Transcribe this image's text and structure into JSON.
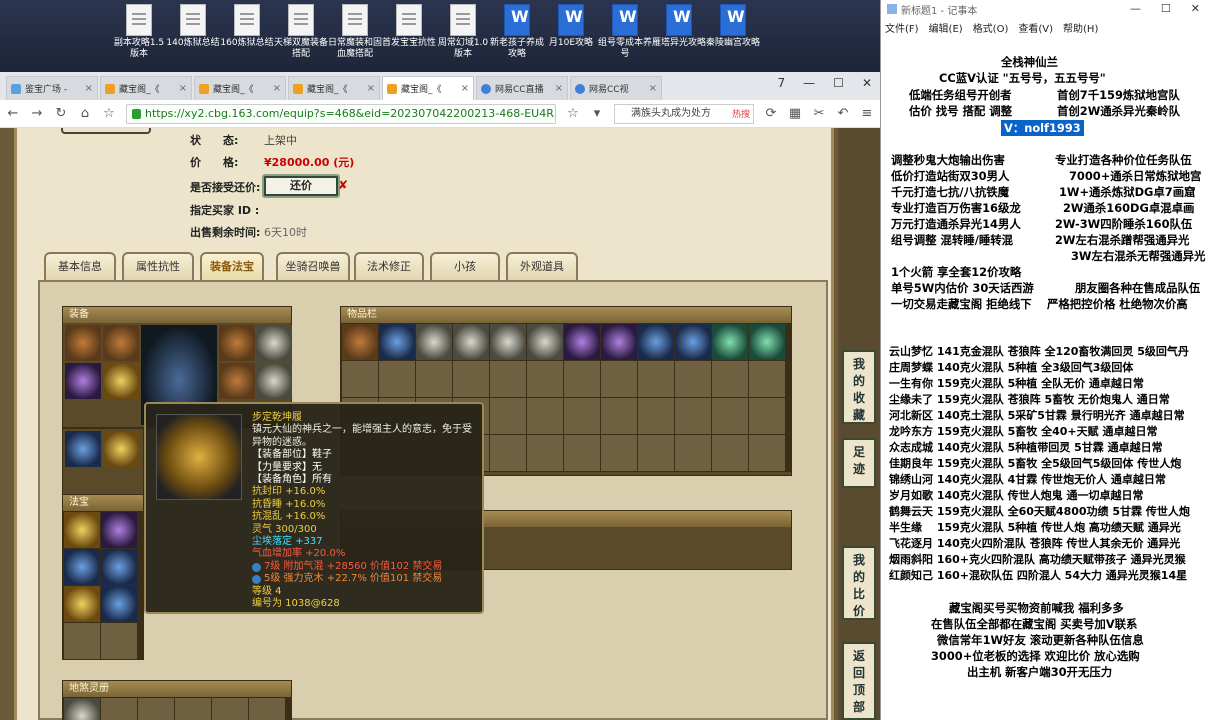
{
  "desktop": {
    "icons": [
      {
        "label": "副本攻略1.5版本",
        "type": "doc"
      },
      {
        "label": "140炼狱总结",
        "type": "doc"
      },
      {
        "label": "160炼狱总结",
        "type": "doc"
      },
      {
        "label": "天梯双魔装备搭配",
        "type": "doc"
      },
      {
        "label": "日常魔装和固血魔搭配",
        "type": "doc"
      },
      {
        "label": "首发宝宝抗性",
        "type": "doc"
      },
      {
        "label": "周常幻域1.0版本",
        "type": "doc"
      },
      {
        "label": "新老孩子养成攻略",
        "type": "word"
      },
      {
        "label": "月10E攻略",
        "type": "word"
      },
      {
        "label": "组号零成本养号",
        "type": "word"
      },
      {
        "label": "雁塔异光攻略",
        "type": "word"
      },
      {
        "label": "秦陵幽宫攻略",
        "type": "word"
      }
    ]
  },
  "browser": {
    "tabs": [
      {
        "label": "鉴宝广场 -",
        "style": "blue"
      },
      {
        "label": "藏宝阁_《",
        "style": ""
      },
      {
        "label": "藏宝阁_《",
        "style": ""
      },
      {
        "label": "藏宝阁_《",
        "style": ""
      },
      {
        "label": "藏宝阁_《",
        "style": "active"
      },
      {
        "label": "网易CC直播",
        "style": "cc"
      },
      {
        "label": "网易CC视",
        "style": "cc"
      }
    ],
    "window_controls": {
      "badge": "7",
      "min": "—",
      "max": "☐",
      "close": "✕"
    },
    "url": "https://xy2.cbg.163.com/equip?s=468&eid=202307042200213-468-EU4R3VZQWN3I",
    "search_text": "满族头丸成为处方"
  },
  "listing": {
    "status_label": "状　　态:",
    "status_value": "上架中",
    "price_label": "价　　格:",
    "price_value": "¥28000.00 (元)",
    "bargain_label": "是否接受还价:",
    "bargain_button": "还价",
    "buyer_label": "指定买家 ID :",
    "time_label": "出售剩余时间:",
    "time_value": "6天10时"
  },
  "detail_tabs": [
    "基本信息",
    "属性抗性",
    "装备法宝",
    "坐骑召唤兽",
    "法术修正",
    "小孩",
    "外观道具"
  ],
  "active_tab": 2,
  "sections": {
    "equip": "装备",
    "fabao": "法宝",
    "inventory": "物品栏",
    "stash": "地煞灵册"
  },
  "tooltip": {
    "name": "步定乾坤履",
    "desc": "镇元大仙的神兵之一，能增强主人的意志，免于受异物的迷惑。",
    "slot": "【装备部位】鞋子",
    "req": "【力量要求】无",
    "role": "【装备角色】所有",
    "attrs": [
      "抗封印 +16.0%",
      "抗昏睡 +16.0%",
      "抗混乱 +16.0%"
    ],
    "lingqi": "灵气 300/300",
    "dodge": "尘埃落定 +337",
    "hp": "气血增加率 +20.0%",
    "gem1": "7级 附加气混 +28560 价值102 禁交易",
    "gem2": "5级 强力克木 +22.7% 价值101 禁交易",
    "level": "等级 4",
    "serial": "编号为 1038@628"
  },
  "sidebar": {
    "collect": "我的收藏",
    "footprint": "足迹",
    "compare": "我的比价",
    "top": "返回顶部"
  },
  "notepad": {
    "title": "新标题1 - 记事本",
    "menu": [
      "文件(F)",
      "编辑(E)",
      "格式(O)",
      "查看(V)",
      "帮助(H)"
    ],
    "lines": [
      "全栈神仙兰",
      "CC蓝V认证 \"五号号，五五号号\"",
      "低端任务组号开创者",
      "首创7千159炼狱地宫队",
      "估价 找号 搭配 调整",
      "首创2W通杀异光秦岭队",
      "V：nolf1993",
      "调整秒鬼大炮输出伤害",
      "专业打造各种价位任务队伍",
      "低价打造站街双30男人",
      "7000+通杀日常炼狱地宫",
      "千元打造七抗/八抗铁魔",
      "1W+通杀炼狱DG卓7画窟",
      "专业打造百万伤害16级龙",
      "2W通杀160DG卓混卓画",
      "万元打造通杀异光14男人",
      "2W-3W四阶睡杀160队伍",
      "组号调整 混转睡/睡转混",
      "2W左右混杀蹭帮强通异光",
      "3W左右混杀无帮强通异光",
      "1个火箭 享全套12价攻略",
      "单号5W内估价 30天话西游",
      "朋友圈各种在售成品队伍",
      "一切交易走藏宝阁 拒绝线下",
      "严格把控价格 杜绝物次价高",
      "云山梦忆 141克金混队 苍狼阵 全120畜牧满回灵 5级回气丹",
      "庄周梦蝶 140克火混队 5种植 全3级回气3级回体",
      "一生有你 159克火混队 5种植 全队无价 通卓越日常",
      "尘缘未了 159克火混队 苍狼阵 5畜牧 无价炮鬼人 通日常",
      "河北新区 140克土混队 5采矿5甘霖 景行明光齐 通卓越日常",
      "龙吟东方 159克火混队 5畜牧 全40+天赋 通卓越日常",
      "众志成城 140克火混队 5种植带回灵 5甘霖 通卓越日常",
      "佳期良年 159克火混队 5畜牧 全5级回气5级回体 传世人炮",
      "锦绣山河 140克火混队 4甘霖 传世炮无价人 通卓越日常",
      "岁月如歌 140克火混队 传世人炮鬼 通一切卓越日常",
      "鹤舞云天 159克火混队 全60天赋4800功绩 5甘霖 传世人炮",
      "半生缘　 159克火混队 5种植 传世人炮 高功绩天赋 通异光",
      "飞花逐月 140克火四阶混队 苍狼阵 传世人其余无价 通异光",
      "烟雨斜阳 160+克火四阶混队 高功绩天赋带孩子 通异光灵猴",
      "红颜知己 160+混砍队伍 四阶混人 54大力 通异光灵猴14星",
      "藏宝阁买号买物资前喊我 福利多多",
      "在售队伍全部都在藏宝阁 买卖号加V联系",
      "微信常年1W好友 滚动更新各种队伍信息",
      "3000+位老板的选择 欢迎比价 放心选购",
      "出主机 新客户端30开无压力"
    ]
  }
}
